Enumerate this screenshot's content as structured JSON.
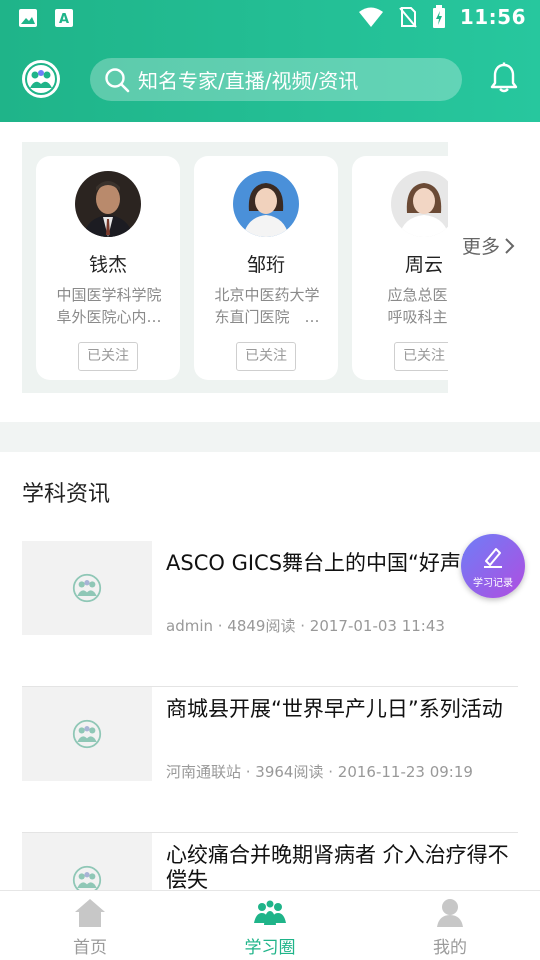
{
  "status_bar": {
    "time": "11:56"
  },
  "header": {
    "search_placeholder": "知名专家/直播/视频/资讯"
  },
  "experts": [
    {
      "name": "钱杰",
      "desc_line1": "中国医学科学院",
      "desc_line2": "阜外医院心内…",
      "follow_label": "已关注"
    },
    {
      "name": "邹珩",
      "desc_line1": "北京中医药大学",
      "desc_line2": "东直门医院　…",
      "follow_label": "已关注"
    },
    {
      "name": "周云",
      "desc_line1": "应急总医院",
      "desc_line2": "呼吸科主任",
      "follow_label": "已关注"
    }
  ],
  "more_label": "更多",
  "section": {
    "title": "学科资讯"
  },
  "news": [
    {
      "title": "ASCO GICS舞台上的中国“好声音”",
      "meta": "admin · 4849阅读 · 2017-01-03 11:43"
    },
    {
      "title": "商城县开展“世界早产儿日”系列活动",
      "meta": "河南通联站 · 3964阅读 · 2016-11-23 09:19"
    },
    {
      "title": "心绞痛合并晚期肾病者 介入治疗得不偿失",
      "meta": ""
    }
  ],
  "fab": {
    "label": "学习记录"
  },
  "bottom_nav": [
    {
      "label": "首页"
    },
    {
      "label": "学习圈"
    },
    {
      "label": "我的"
    }
  ],
  "colors": {
    "brand": "#1fb489",
    "fab_start": "#6e7ef7",
    "fab_end": "#b04de0"
  }
}
